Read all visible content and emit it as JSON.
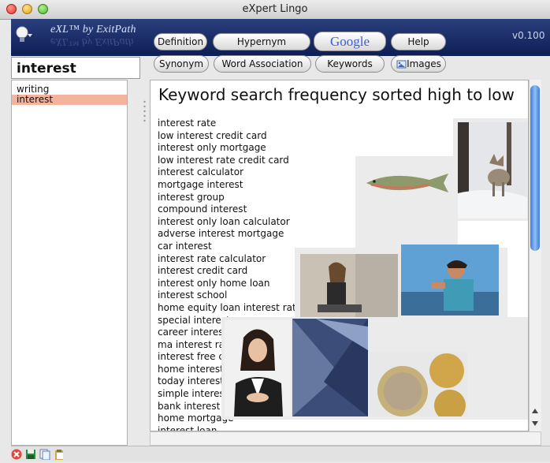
{
  "window": {
    "title": "eXpert Lingo"
  },
  "brand": {
    "name": "eXL™ by ExitPath",
    "version": "v0.100"
  },
  "buttons_row1": [
    "Definition",
    "Hypernym",
    "Google",
    "Help"
  ],
  "buttons_row2": [
    "Synonym",
    "Word Association",
    "Keywords",
    "Images"
  ],
  "search": {
    "value": "interest"
  },
  "history": {
    "items": [
      "writing",
      "interest"
    ],
    "selected": "interest"
  },
  "main": {
    "heading": "Keyword search frequency sorted high to low",
    "keywords": [
      "interest rate",
      "low interest credit card",
      "interest only mortgage",
      "low interest rate credit card",
      "interest calculator",
      "mortgage interest",
      "interest group",
      "compound interest",
      "interest only loan calculator",
      "adverse interest mortgage",
      "car interest",
      "interest rate calculator",
      "interest credit card",
      "interest only home loan",
      "interest school",
      "home equity loan interest rate",
      "special interest",
      "career interest",
      "ma interest rate",
      "interest free credit",
      "home interest",
      "today interest",
      "simple interest",
      "bank interest",
      "home mortgage",
      "interest loan"
    ]
  },
  "images": [
    "coyote in snow",
    "rainbow trout",
    "woman reading on bench",
    "man using phone",
    "businesswoman portrait",
    "blue fabric",
    "euro coins"
  ],
  "colors": {
    "selection": "#f4b39c",
    "header_band": "#1a2d66",
    "google_blue": "#3b5fd4"
  },
  "icons": [
    "lightbulb-icon",
    "delete-icon",
    "save-icon",
    "copy-icon",
    "paste-icon"
  ]
}
